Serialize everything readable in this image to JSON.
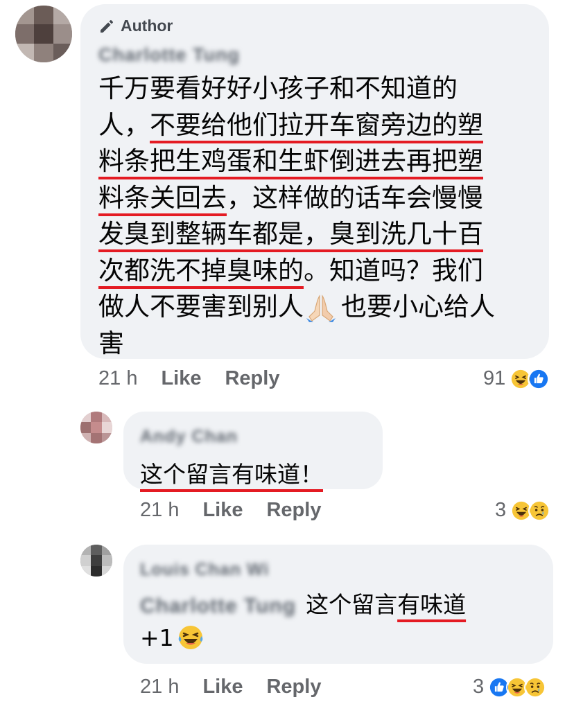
{
  "comment": {
    "author_badge": "Author",
    "author_name": "Charlotte Tung",
    "lines": [
      [
        "千万要看好好小孩子和不知道的",
        ""
      ],
      [
        "人，",
        "不要给他们拉开车窗旁边的塑"
      ],
      [
        "",
        "料条把生鸡蛋和生虾倒进去再把塑"
      ],
      [
        "料条关回去",
        "，这样做的话车会慢慢"
      ],
      [
        "发臭到整辆车都是，臭到洗几十百",
        ""
      ],
      [
        "次都洗不掉臭味的",
        "。知道吗？我们"
      ],
      [
        "做人不要害到别人",
        "也要小心给人"
      ],
      [
        "害",
        ""
      ]
    ],
    "time": "21 h",
    "like_label": "Like",
    "reply_label": "Reply",
    "reaction_count": "91",
    "reactions": [
      "haha",
      "like"
    ]
  },
  "replies": [
    {
      "author_name": "Andy Chan",
      "text": "这个留言有味道！",
      "time": "21 h",
      "like_label": "Like",
      "reply_label": "Reply",
      "reaction_count": "3",
      "reactions": [
        "haha",
        "sad"
      ]
    },
    {
      "author_name": "Louis Chan Wi",
      "mention": "Charlotte Tung",
      "text_part1": "这个留言",
      "text_part2": "有味道",
      "text_line2": "+1",
      "time": "21 h",
      "like_label": "Like",
      "reply_label": "Reply",
      "reaction_count": "3",
      "reactions": [
        "like",
        "haha",
        "sad"
      ]
    }
  ],
  "colors": {
    "bubble": "#f0f2f5",
    "underline": "#e41b23",
    "meta": "#65676b",
    "like_blue": "#1877f2",
    "emoji_yellow": "#f7c536"
  }
}
